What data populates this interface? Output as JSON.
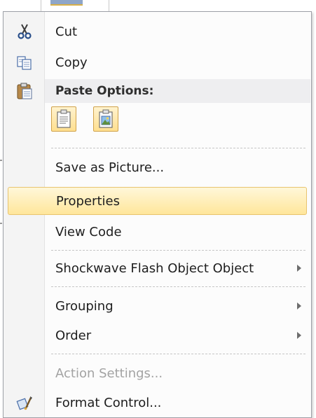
{
  "menu": {
    "header": "Paste Options:",
    "items": [
      {
        "label": "Cut"
      },
      {
        "label": "Copy"
      },
      {
        "label": "Save as Picture..."
      },
      {
        "label": "Properties"
      },
      {
        "label": "View Code"
      },
      {
        "label": "Shockwave Flash Object Object"
      },
      {
        "label": "Grouping"
      },
      {
        "label": "Order"
      },
      {
        "label": "Action Settings..."
      },
      {
        "label": "Format Control..."
      }
    ],
    "highlighted": "Properties",
    "disabled": [
      "Action Settings..."
    ],
    "icons": [
      "scissors-icon",
      "copy-icon",
      "paste-icon",
      "paste-keep-source-icon",
      "paste-as-picture-icon",
      "format-control-icon"
    ],
    "colors": {
      "highlight_top": "#fff7d9",
      "highlight_bottom": "#ffe69b",
      "highlight_border": "#e8c46f",
      "disabled_text": "#a3a3a3"
    }
  }
}
